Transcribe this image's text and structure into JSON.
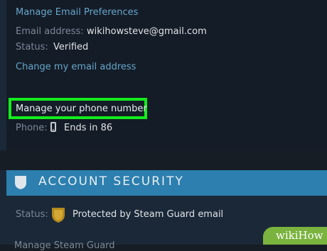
{
  "email": {
    "manage_link": "Manage Email Preferences",
    "address_label": "Email address:",
    "address_value": "wikihowsteve@gmail.com",
    "status_label": "Status:",
    "status_value": "Verified",
    "change_link": "Change my email address"
  },
  "phone": {
    "manage_link": "Manage your phone number",
    "label": "Phone:",
    "value": "Ends in 86",
    "icon": "phone-icon"
  },
  "security": {
    "title": "ACCOUNT SECURITY",
    "icon": "shield-icon",
    "status_label": "Status:",
    "status_value": "Protected by Steam Guard email",
    "status_icon": "steam-guard-icon",
    "partial_line": "Manage Steam Guard"
  },
  "watermark": {
    "text": "wikiHow"
  },
  "colors": {
    "highlight": "#12ec1b",
    "banner": "#2c7fae",
    "link": "#66a6c9"
  }
}
